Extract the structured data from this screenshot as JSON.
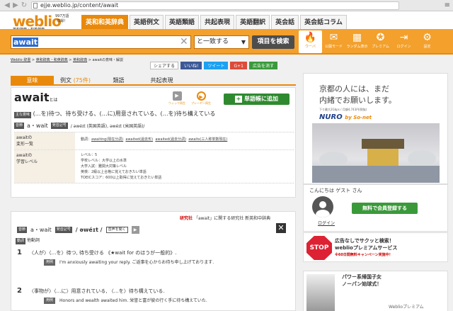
{
  "browser": {
    "url": "ejje.weblio.jp/content/await"
  },
  "site": {
    "logo": "weblio",
    "logo_sub": "英和辞典・和英辞典",
    "logo_badge_1": "997万語",
    "logo_badge_2": "収録！",
    "nav": [
      "英和和英辞典",
      "英語例文",
      "英語類語",
      "共起表現",
      "英語翻訳",
      "英会話",
      "英会話コラム"
    ]
  },
  "search": {
    "value": "await",
    "match_option": "と一致する",
    "button": "項目を検索",
    "icons": [
      {
        "icon": "fire-icon",
        "label": "ウーバ"
      },
      {
        "icon": "mail-icon",
        "label": "公開モード"
      },
      {
        "icon": "grid-icon",
        "label": "ランダム表示"
      },
      {
        "icon": "medal-icon",
        "label": "プレミアム"
      },
      {
        "icon": "login-icon",
        "label": "ログイン"
      },
      {
        "icon": "gear-icon",
        "label": "設定"
      }
    ]
  },
  "breadcrumb": [
    "Weblio 辞書",
    "英和辞典・和英辞典",
    "英和辞典",
    "awaitの意味・解説"
  ],
  "share": [
    "シェアする",
    "いいね!",
    "ツイート",
    "G+1",
    "広告を消す"
  ],
  "tabs": [
    {
      "label": "意味",
      "count": ""
    },
    {
      "label": "例文",
      "count": "(75件)"
    },
    {
      "label": "類語",
      "count": ""
    },
    {
      "label": "共起表現",
      "count": ""
    }
  ],
  "entry": {
    "headword": "await",
    "headword_suffix": "とは",
    "audio1": "ウィック再生",
    "audio2": "プレーヤー再生",
    "add_button": "単語帳に追加",
    "main_meaning_tag": "主な意味",
    "main_meaning": "(…を)待つ、待ち受ける、(…に)用意されている、(…を)待ち構えている",
    "pron_tag": "音節",
    "syllables": "a・wait",
    "pron_tag2": "発音記号",
    "pron": "/ əwéɪt (英国英語), əwéɪt (米国英語)/",
    "info": [
      {
        "label": "awaitの\n変形一覧",
        "value_prefix": "動詞：",
        "forms": [
          "awaiting(現在分詞)",
          "awaited(過去形)",
          "awaited(過去分詞)",
          "awaits(三人称単数現在)"
        ]
      },
      {
        "label": "awaitの\n学習レベル",
        "lines": [
          "レベル：5",
          "学校レベル：大学以上の水準",
          "大学入試：難関大対策レベル",
          "英検：2級以上合格に覚えておきたい単語",
          "TOEICスコア：600以上取得に覚えておきたい単語"
        ]
      }
    ]
  },
  "dict": {
    "publisher": "研究社",
    "heading": "「await」に関する研究社 新英和中辞典",
    "syll_tag": "音節",
    "syllables": "a・wait",
    "pron_tag": "発音記号",
    "pron": "/ əwéɪt /",
    "listen": "音声を聞く",
    "verb_tag": "動詞",
    "verb_type": "他動詞",
    "close": "✕",
    "senses": [
      {
        "num": "1",
        "text": "〈人が〉〈…を〉待つ, 待ち受ける 《★wait for のほうが一般的》.",
        "example_label": "用例",
        "example": "I'm anxiously awaiting your reply. ご返事を心からお待ち申し上げております."
      },
      {
        "num": "2",
        "text": "〈事物が〉〈…に〉用意されている, 〈…を〉待ち構えている.",
        "example_label": "用例",
        "example": "Honors and wealth awaited him. 栄誉と富が彼の行く手に待ち構えていた."
      }
    ]
  },
  "side": {
    "ad_line1": "京都の人には、まだ",
    "ad_line2": "内緒でお願いします。",
    "ad_fine": "下り最大2Gbps / 月額4,743円(税抜)",
    "ad_brand": "NURO",
    "ad_brand_sub": "by So-net",
    "greeting": "こんにちは ゲスト さん",
    "login": "ログイン",
    "register": "無料で会員登録する",
    "stop": "STOP",
    "premium_line1": "広告なしでサクッと検索！",
    "premium_line2": "weblioプレミアムサービス",
    "premium_sub": "※60日間無料キャンペーン実施中！",
    "ad2_line1": "パワー系帰国子女",
    "ad2_line2": "ノーパン始球式！",
    "ad2_brand": "Weblioプレミアム"
  }
}
